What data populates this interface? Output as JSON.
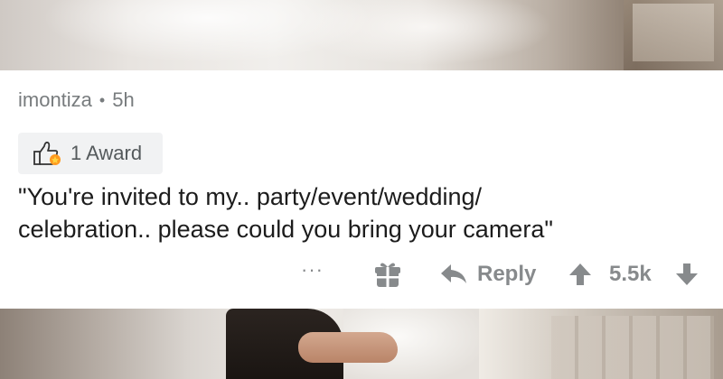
{
  "comment": {
    "author": "imontiza",
    "separator": "•",
    "age": "5h",
    "award_label": "1 Award",
    "body_line1": "\"You're invited to my.. party/event/wedding/",
    "body_line2": "celebration.. please could you bring your camera\""
  },
  "actions": {
    "more_label": "···",
    "reply_label": "Reply",
    "score": "5.5k"
  },
  "icons": {
    "award": "thumbs-up-award-icon",
    "more": "more-options-icon",
    "gift": "gift-icon",
    "reply": "reply-arrow-icon",
    "upvote": "upvote-arrow-icon",
    "downvote": "downvote-arrow-icon"
  },
  "colors": {
    "meta_text": "#787c7e",
    "action_gray": "#878a8c",
    "award_bg": "#f1f2f3",
    "body_text": "#1c1c1c"
  }
}
